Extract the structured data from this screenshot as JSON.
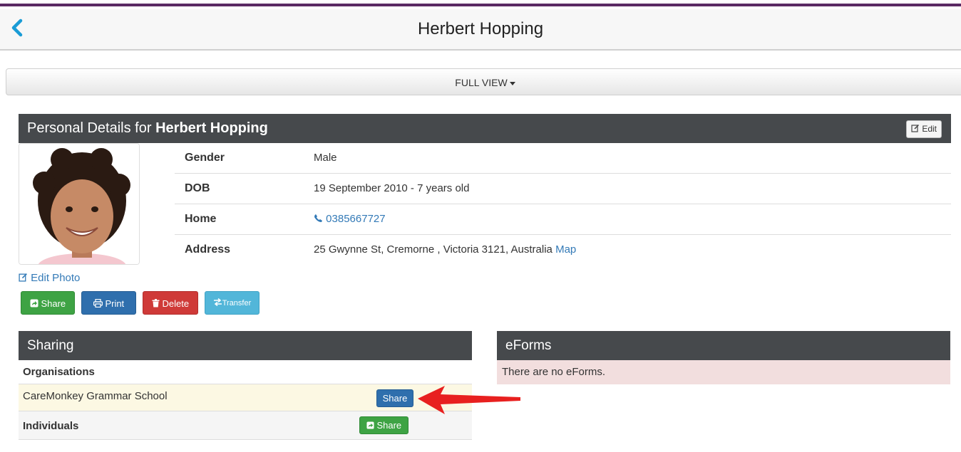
{
  "header": {
    "title": "Herbert Hopping"
  },
  "view_selector": {
    "label": "FULL VIEW"
  },
  "personal": {
    "title_prefix": "Personal Details for",
    "name": "Herbert Hopping",
    "edit_label": "Edit",
    "fields": [
      {
        "label": "Gender",
        "value": "Male"
      },
      {
        "label": "DOB",
        "value": "19 September 2010 - 7 years old"
      },
      {
        "label": "Home",
        "value": "0385667727"
      },
      {
        "label": "Address",
        "value": "25 Gwynne St, Cremorne , Victoria 3121, Australia",
        "link": "Map"
      }
    ],
    "edit_photo_label": "Edit Photo",
    "actions": {
      "share": "Share",
      "print": "Print",
      "delete": "Delete",
      "transfer": "Transfer"
    }
  },
  "sharing": {
    "title": "Sharing",
    "organisations_label": "Organisations",
    "org_name": "CareMonkey Grammar School",
    "org_share_label": "Share",
    "individuals_label": "Individuals",
    "individuals_share_label": "Share"
  },
  "eforms": {
    "title": "eForms",
    "empty_message": "There are no eForms."
  },
  "colors": {
    "accent_top": "#5b2a64",
    "panel_header": "#46494c",
    "link": "#337ab7",
    "success": "#3ea344",
    "primary": "#2f6fad",
    "danger": "#cf3a38",
    "info": "#52b6d9",
    "annotation_arrow": "#e8201f"
  }
}
